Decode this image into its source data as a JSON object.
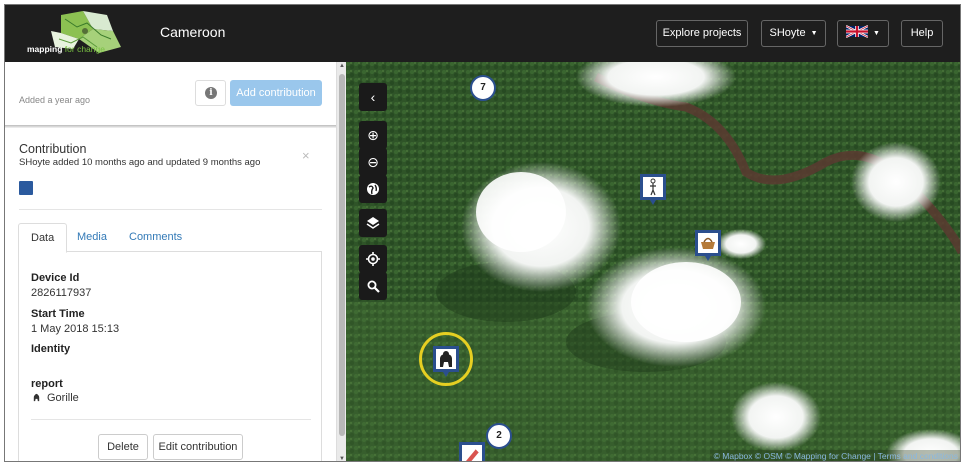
{
  "header": {
    "logo_text_bold": "mapping",
    "logo_text_light": "for change",
    "title": "Cameroon",
    "explore_label": "Explore projects",
    "user_label": "SHoyte",
    "lang_flag": "uk-flag-icon",
    "help_label": "Help"
  },
  "panel": {
    "added_text": "Added a year ago",
    "add_contribution_label": "Add contribution",
    "contribution_title": "Contribution",
    "contribution_meta": "SHoyte added 10 months ago and updated 9 months ago",
    "close_glyph": "×",
    "category_color": "#2b5a9e",
    "tabs": [
      {
        "label": "Data",
        "active": true
      },
      {
        "label": "Media",
        "active": false
      },
      {
        "label": "Comments",
        "active": false
      }
    ],
    "fields": {
      "device_id_label": "Device Id",
      "device_id_value": "2826117937",
      "start_time_label": "Start Time",
      "start_time_value": "1 May 2018 15:13",
      "identity_label": "Identity",
      "report_label": "report",
      "report_value": "Gorille"
    },
    "delete_label": "Delete",
    "edit_label": "Edit contribution"
  },
  "map": {
    "controls": [
      {
        "name": "collapse-panel-button",
        "icon": "chevron-left-icon",
        "glyph": "‹"
      },
      {
        "name": "zoom-in-button",
        "icon": "plus-circle-icon",
        "glyph": "⊕"
      },
      {
        "name": "zoom-out-button",
        "icon": "minus-circle-icon",
        "glyph": "⊖"
      },
      {
        "name": "globe-button",
        "icon": "globe-icon",
        "glyph": ""
      },
      {
        "name": "layers-button",
        "icon": "layers-icon",
        "glyph": ""
      },
      {
        "name": "locate-button",
        "icon": "locate-icon",
        "glyph": ""
      },
      {
        "name": "search-map-button",
        "icon": "search-icon",
        "glyph": ""
      }
    ],
    "cluster_top": "7",
    "cluster_bottom": "2",
    "attribution": "© Mapbox © OSM © Mapping for Change | Terms and conditions"
  }
}
